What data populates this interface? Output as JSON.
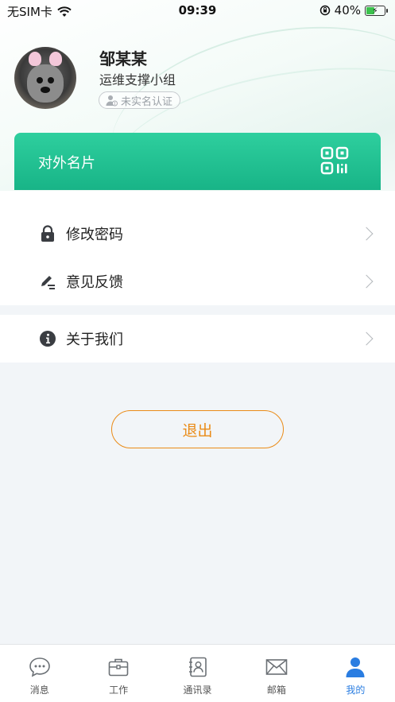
{
  "status_bar": {
    "carrier": "无SIM卡",
    "time": "09:39",
    "battery": "40%",
    "battery_level": 0.4
  },
  "profile": {
    "name": "邹某某",
    "group": "运维支撑小组",
    "auth_status": "未实名认证"
  },
  "card": {
    "label": "对外名片",
    "icon": "qr-code-icon",
    "color_top": "#2ecf9e",
    "color_bottom": "#18b487"
  },
  "menu": {
    "change_password": "修改密码",
    "feedback": "意见反馈",
    "about_us": "关于我们"
  },
  "logout_label": "退出",
  "logout_color": "#ea8b17",
  "tabbar": {
    "items": [
      {
        "label": "消息",
        "icon": "message-icon"
      },
      {
        "label": "工作",
        "icon": "briefcase-icon"
      },
      {
        "label": "通讯录",
        "icon": "contacts-icon"
      },
      {
        "label": "邮箱",
        "icon": "mail-icon"
      },
      {
        "label": "我的",
        "icon": "user-icon"
      }
    ],
    "active_index": 4,
    "active_color": "#2a7de1"
  }
}
